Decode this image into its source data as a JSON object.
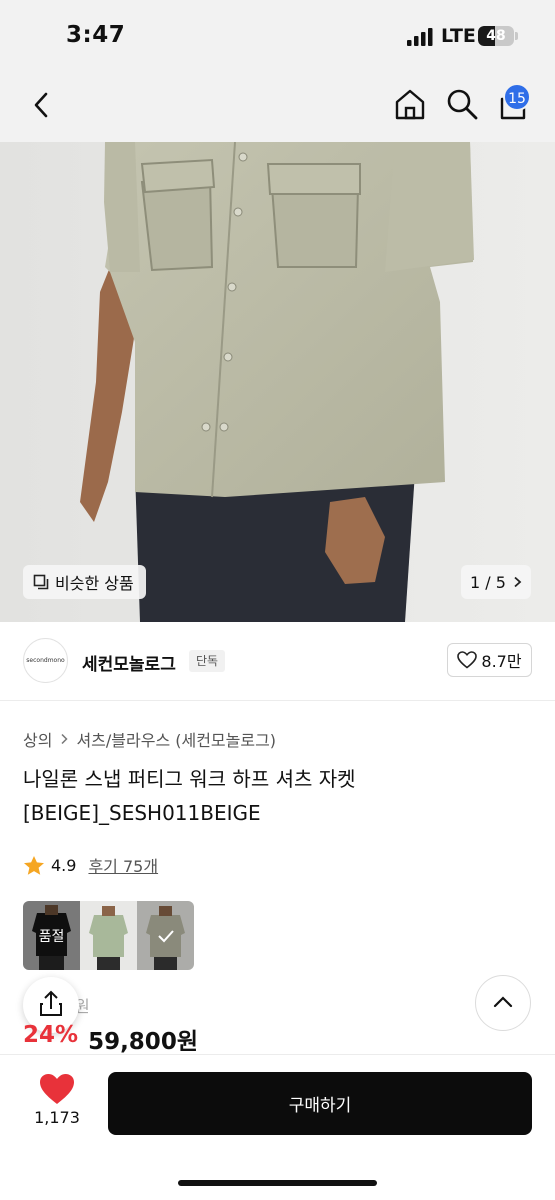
{
  "status": {
    "time": "3:47",
    "network": "LTE",
    "battery": "48",
    "battery_level": 0.48
  },
  "nav": {
    "back_icon": "chevron-left-icon",
    "home_icon": "home-icon",
    "search_icon": "search-icon",
    "cart_icon": "cart-icon",
    "cart_count": "15"
  },
  "colors": {
    "accent": "#2f6ee8",
    "discount": "#e8323a",
    "buy_bg": "#0c0c0c",
    "heart": "#e8323a",
    "star": "#f5a623"
  },
  "hero": {
    "similar_label": "비슷한 상품",
    "page_counter": "1 / 5"
  },
  "brand": {
    "logo_text": "secondmono",
    "name": "세컨모놀로그",
    "tag": "단독",
    "likes": "8.7만"
  },
  "product": {
    "breadcrumb": [
      "상의",
      "셔츠/블라우스 (세컨모놀로그)"
    ],
    "title": "나일론 스냅 퍼티그 워크 하프 셔츠 자켓 [BEIGE]_SESH011BEIGE",
    "rating": "4.9",
    "reviews": "후기 75개",
    "swatches": [
      {
        "color": "black",
        "status": "품절"
      },
      {
        "color": "sage",
        "status": ""
      },
      {
        "color": "beige",
        "status": "selected"
      }
    ],
    "original_price": "원",
    "discount": "24%",
    "price": "59,800원"
  },
  "bottom": {
    "like_count": "1,173",
    "buy_label": "구매하기"
  }
}
